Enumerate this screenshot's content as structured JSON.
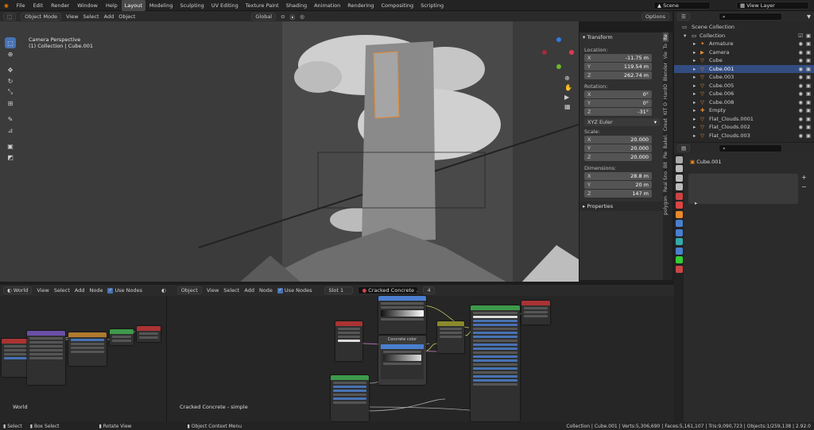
{
  "topbar": {
    "menus": [
      "File",
      "Edit",
      "Render",
      "Window",
      "Help"
    ],
    "workspaces": [
      "Layout",
      "Modeling",
      "Sculpting",
      "UV Editing",
      "Texture Paint",
      "Shading",
      "Animation",
      "Rendering",
      "Compositing",
      "Scripting"
    ],
    "active_workspace": "Layout",
    "scene": "Scene",
    "view_layer": "View Layer"
  },
  "viewport_header": {
    "mode": "Object Mode",
    "menus": [
      "View",
      "Select",
      "Add",
      "Object"
    ],
    "orientation": "Global",
    "options": "Options"
  },
  "viewport": {
    "overlay_line1": "Camera Perspective",
    "overlay_line2": "(1) Collection | Cube.001"
  },
  "transform_panel": {
    "title": "Transform",
    "location_label": "Location:",
    "location": [
      {
        "k": "X",
        "v": "-11.75 m"
      },
      {
        "k": "Y",
        "v": "119.54 m"
      },
      {
        "k": "Z",
        "v": "262.74 m"
      }
    ],
    "rotation_label": "Rotation:",
    "rotation": [
      {
        "k": "X",
        "v": "0°"
      },
      {
        "k": "Y",
        "v": "0°"
      },
      {
        "k": "Z",
        "v": "-31°"
      }
    ],
    "rotation_mode": "XYZ Euler",
    "scale_label": "Scale:",
    "scale": [
      {
        "k": "X",
        "v": "20.000"
      },
      {
        "k": "Y",
        "v": "20.000"
      },
      {
        "k": "Z",
        "v": "20.000"
      }
    ],
    "dimensions_label": "Dimensions:",
    "dimensions": [
      {
        "k": "X",
        "v": "28.8 m"
      },
      {
        "k": "Y",
        "v": "20 m"
      },
      {
        "k": "Z",
        "v": "147 m"
      }
    ],
    "properties_title": "Properties"
  },
  "sidebar_tabs": [
    "Ite",
    "To",
    "Vie",
    "Blender",
    "HardO",
    "KIT O",
    "Creat",
    "Bakel.",
    "Pie",
    "Bit",
    "Real Sno",
    "polygon"
  ],
  "outliner": {
    "root": "Scene Collection",
    "collection": "Collection",
    "items": [
      {
        "name": "Armature",
        "selected": false
      },
      {
        "name": "Camera",
        "selected": false
      },
      {
        "name": "Cube",
        "selected": false
      },
      {
        "name": "Cube.001",
        "selected": true
      },
      {
        "name": "Cube.003",
        "selected": false
      },
      {
        "name": "Cube.005",
        "selected": false
      },
      {
        "name": "Cube.006",
        "selected": false
      },
      {
        "name": "Cube.008",
        "selected": false
      },
      {
        "name": "Empty",
        "selected": false
      },
      {
        "name": "Flat_Clouds.0001",
        "selected": false
      },
      {
        "name": "Flat_Clouds.002",
        "selected": false
      },
      {
        "name": "Flat_Clouds.003",
        "selected": false
      }
    ]
  },
  "properties": {
    "object_name": "Cube.001"
  },
  "node_editor_left": {
    "type": "World",
    "menus": [
      "View",
      "Select",
      "Add",
      "Node"
    ],
    "use_nodes": "Use Nodes",
    "label": "World"
  },
  "node_editor_right": {
    "object": "Object",
    "menus": [
      "View",
      "Select",
      "Add",
      "Node"
    ],
    "use_nodes": "Use Nodes",
    "slot": "Slot 1",
    "material": "Cracked Concrete ...",
    "users": "4",
    "label": "Cracked Concrete - simple",
    "frame_label": "Concrete color"
  },
  "statusbar": {
    "select": "Select",
    "box_select": "Box Select",
    "rotate_view": "Rotate View",
    "context_menu": "Object Context Menu",
    "stats": "Collection | Cube.001 | Verts:5,306,690 | Faces:5,161,107 | Tris:9,090,723 | Objects:1/259,138 | 2.92.0"
  }
}
